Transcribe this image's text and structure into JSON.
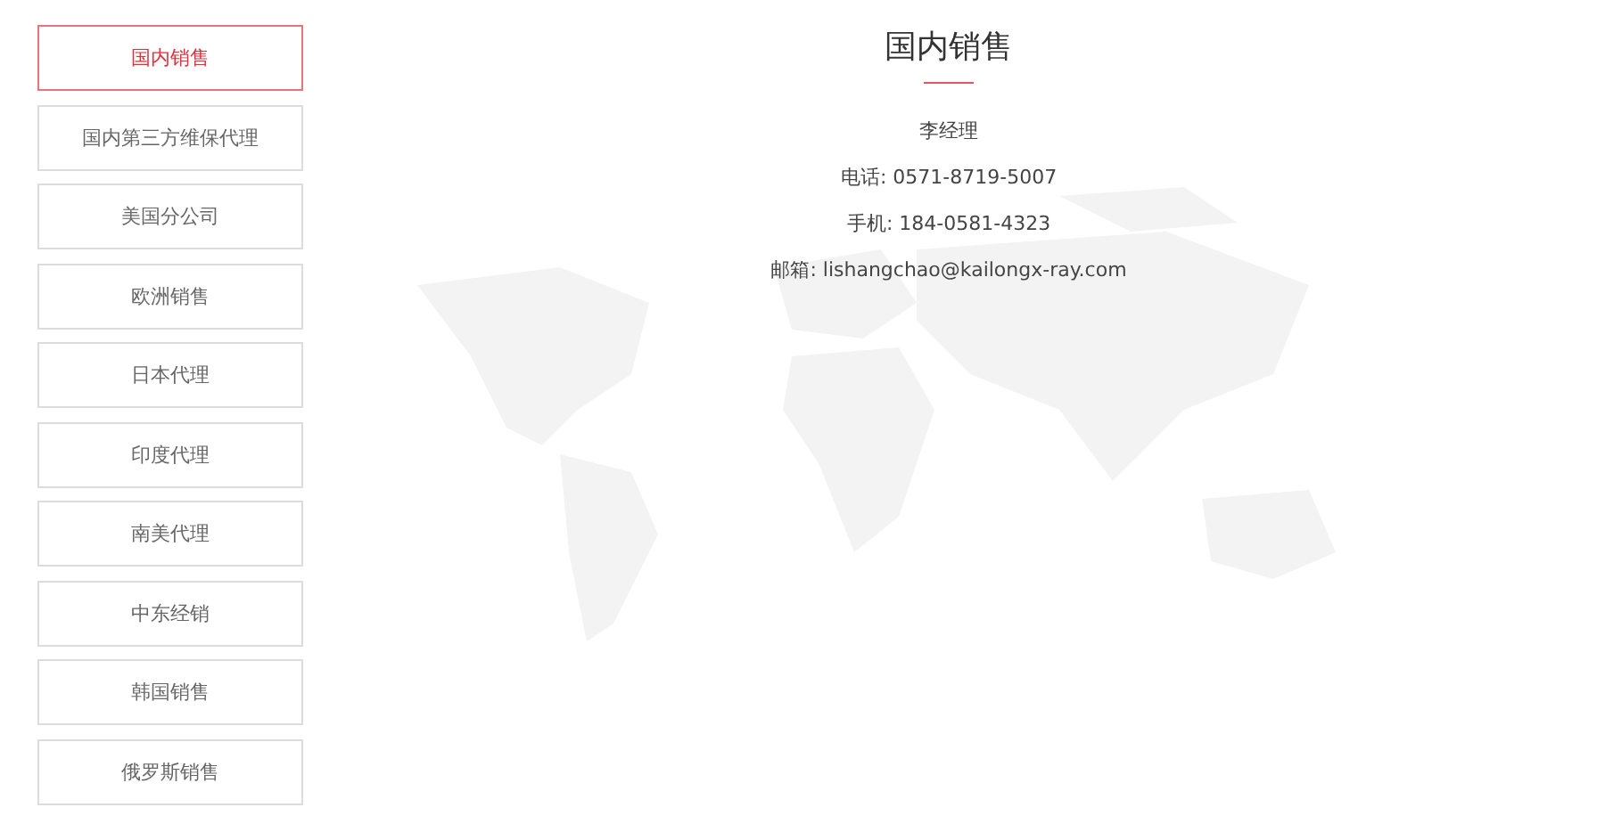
{
  "sidebar": {
    "items": [
      {
        "label": "国内销售",
        "selected": true
      },
      {
        "label": "国内第三方维保代理",
        "selected": false
      },
      {
        "label": "美国分公司",
        "selected": false
      },
      {
        "label": "欧洲销售",
        "selected": false
      },
      {
        "label": "日本代理",
        "selected": false
      },
      {
        "label": "印度代理",
        "selected": false
      },
      {
        "label": "南美代理",
        "selected": false
      },
      {
        "label": "中东经销",
        "selected": false
      },
      {
        "label": "韩国销售",
        "selected": false
      },
      {
        "label": "俄罗斯销售",
        "selected": false
      }
    ]
  },
  "contact": {
    "title": "国内销售",
    "lines": [
      "李经理",
      "电话: 0571-8719-5007",
      "手机: 184-0581-4323",
      "邮箱: lishangchao@kailongx-ray.com"
    ]
  }
}
